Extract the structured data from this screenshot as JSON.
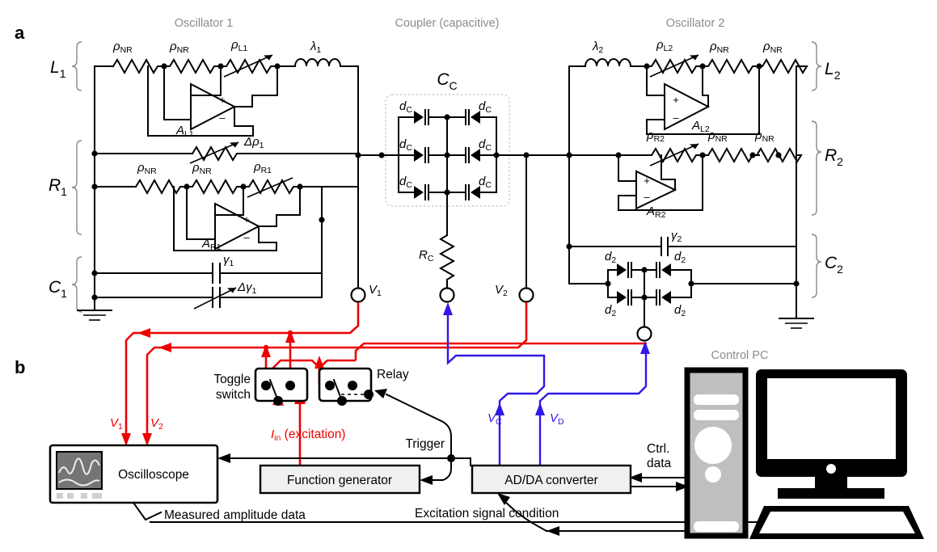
{
  "figure": {
    "panel_a_label": "a",
    "panel_b_label": "b"
  },
  "headers": {
    "osc1": "Oscillator 1",
    "coupler": "Coupler (capacitive)",
    "osc2": "Oscillator 2",
    "control_pc": "Control PC"
  },
  "osc1": {
    "branch_L": "L",
    "branch_L_sub": "1",
    "branch_R": "R",
    "branch_R_sub": "1",
    "branch_C": "C",
    "branch_C_sub": "1",
    "L_res1": "ρ",
    "L_res1_sub": "NR",
    "L_res2": "ρ",
    "L_res2_sub": "NR",
    "L_var": "ρ",
    "L_var_sub": "L1",
    "inductor": "λ",
    "inductor_sub": "1",
    "opamp_L": "A",
    "opamp_L_sub": "L1",
    "delta_rho": "Δρ",
    "delta_rho_sub": "1",
    "R_res1": "ρ",
    "R_res1_sub": "NR",
    "R_res2": "ρ",
    "R_res2_sub": "NR",
    "R_var": "ρ",
    "R_var_sub": "R1",
    "opamp_R": "A",
    "opamp_R_sub": "R1",
    "cap_gamma": "γ",
    "cap_gamma_sub": "1",
    "cap_dgamma": "Δγ",
    "cap_dgamma_sub": "1"
  },
  "coupler": {
    "title": "C",
    "title_sub": "C",
    "diode": "d",
    "diode_sub": "C",
    "diode_count": 6,
    "resistor": "R",
    "resistor_sub": "C"
  },
  "osc2": {
    "branch_L": "L",
    "branch_L_sub": "2",
    "branch_R": "R",
    "branch_R_sub": "2",
    "branch_C": "C",
    "branch_C_sub": "2",
    "inductor": "λ",
    "inductor_sub": "2",
    "L_var": "ρ",
    "L_var_sub": "L2",
    "L_res1": "ρ",
    "L_res1_sub": "NR",
    "L_res2": "ρ",
    "L_res2_sub": "NR",
    "opamp_L": "A",
    "opamp_L_sub": "L2",
    "R_var": "ρ",
    "R_var_sub": "R2",
    "R_res1": "ρ",
    "R_res1_sub": "NR",
    "R_res2": "ρ",
    "R_res2_sub": "NR",
    "opamp_R": "A",
    "opamp_R_sub": "R2",
    "cap_gamma": "γ",
    "cap_gamma_sub": "2",
    "diode": "d",
    "diode_sub": "2",
    "diode_count": 4
  },
  "terminals": {
    "v1": "V",
    "v1_sub": "1",
    "v2": "V",
    "v2_sub": "2",
    "vc": "V",
    "vc_sub": "C",
    "vd": "V",
    "vd_sub": "D"
  },
  "panel_b": {
    "oscilloscope": "Oscilloscope",
    "function_generator": "Function generator",
    "adda_converter": "AD/DA converter",
    "toggle_switch_line1": "Toggle",
    "toggle_switch_line2": "switch",
    "relay": "Relay",
    "trigger": "Trigger",
    "iin": "I",
    "iin_sub": "in",
    "iin_rest": " (excitation)",
    "measured_amplitude": "Measured amplitude data",
    "excitation_condition": "Excitation signal condition",
    "ctrl_line1": "Ctrl.",
    "ctrl_line2": "data",
    "v1_probe": "V",
    "v1_probe_sub": "1",
    "v2_probe": "V",
    "v2_probe_sub": "2"
  },
  "colors": {
    "signal_red": "#ee0000",
    "signal_blue": "#3018e8",
    "header_gray": "#8c8c8c",
    "box_fill": "#f0f0f0",
    "pc_gray": "#bfbfbf"
  }
}
